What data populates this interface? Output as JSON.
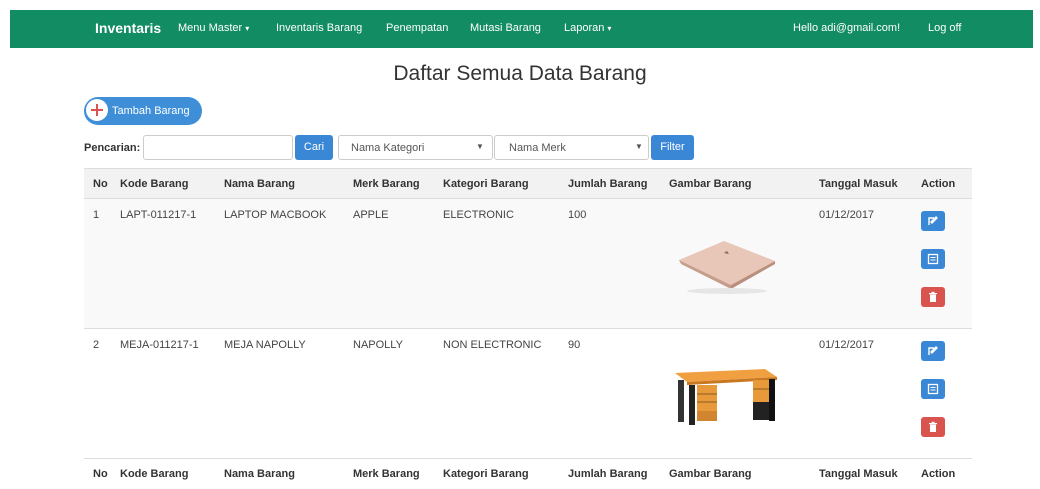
{
  "navbar": {
    "brand": "Inventaris",
    "links": [
      {
        "label": "Menu Master",
        "caret": "▾"
      },
      {
        "label": "Inventaris Barang"
      },
      {
        "label": "Penempatan"
      },
      {
        "label": "Mutasi Barang"
      },
      {
        "label": "Laporan",
        "caret": "▾"
      }
    ],
    "greeting": "Hello adi@gmail.com!",
    "logoff": "Log off",
    "color": "#128c63"
  },
  "page": {
    "title": "Daftar Semua Data Barang",
    "add_button": "Tambah Barang"
  },
  "filters": {
    "search_label": "Pencarian:",
    "search_value": "",
    "search_button": "Cari",
    "kategori_select": "Nama Kategori",
    "merk_select": "Nama Merk",
    "filter_button": "Filter"
  },
  "table": {
    "headers": [
      "No",
      "Kode Barang",
      "Nama Barang",
      "Merk Barang",
      "Kategori Barang",
      "Jumlah Barang",
      "Gambar Barang",
      "Tanggal Masuk",
      "Action"
    ],
    "rows": [
      {
        "no": "1",
        "kode": "LAPT-011217-1",
        "nama": "LAPTOP MACBOOK",
        "merk": "APPLE",
        "kategori": "ELECTRONIC",
        "jumlah": "100",
        "gambar": "laptop-image",
        "tanggal": "01/12/2017"
      },
      {
        "no": "2",
        "kode": "MEJA-011217-1",
        "nama": "MEJA NAPOLLY",
        "merk": "NAPOLLY",
        "kategori": "NON ELECTRONIC",
        "jumlah": "90",
        "gambar": "desk-image",
        "tanggal": "01/12/2017"
      }
    ]
  },
  "icons": {
    "edit": "edit-icon",
    "detail": "detail-icon",
    "delete": "trash-icon"
  }
}
